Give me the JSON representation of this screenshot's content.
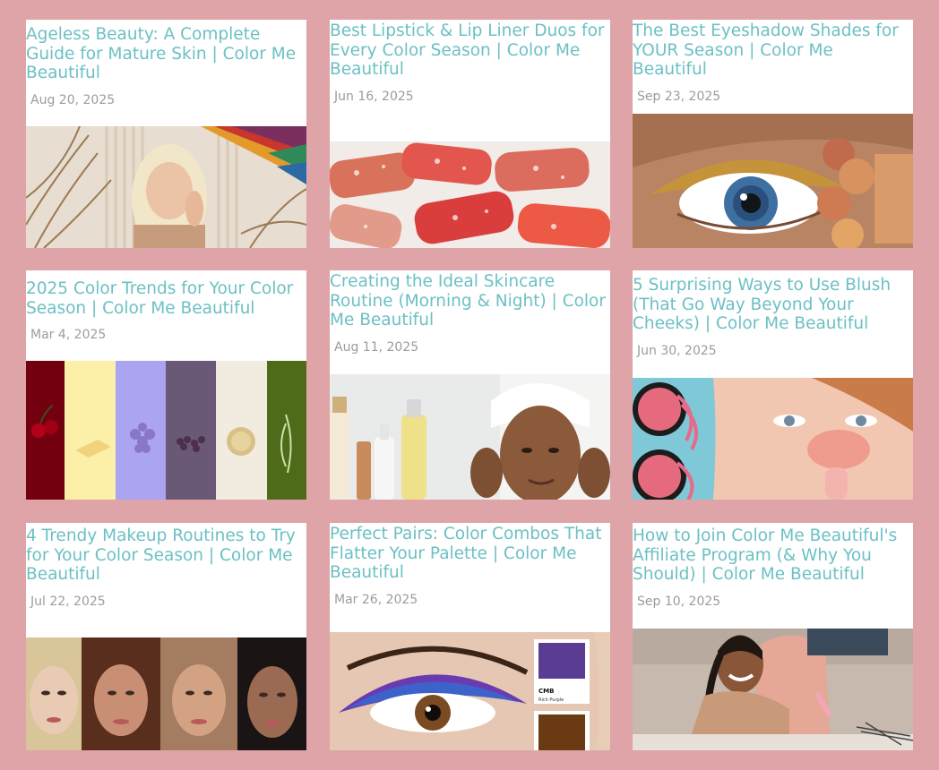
{
  "colors": {
    "page_background": "#dfa4a7",
    "card_background": "#ffffff",
    "title_color": "#6cc0c4",
    "date_color": "#9c9c9c"
  },
  "posts": [
    {
      "title": "Ageless Beauty: A Complete Guide for Mature Skin | Color Me Beautiful",
      "date": "Aug 20, 2025",
      "image": "mature-woman-with-color-fan-photo"
    },
    {
      "title": "Best Lipstick & Lip Liner Duos for Every Color Season | Color Me Beautiful",
      "date": "Jun 16, 2025",
      "image": "lipsticks-with-water-drops-photo"
    },
    {
      "title": "The Best Eyeshadow Shades for YOUR Season | Color Me Beautiful",
      "date": "Sep 23, 2025",
      "image": "blue-eye-with-gold-eyeshadow-photo"
    },
    {
      "title": "2025 Color Trends for Your Color Season | Color Me Beautiful",
      "date": "Mar 4, 2025",
      "image": "color-trend-stripes-photo"
    },
    {
      "title": "Creating the Ideal Skincare Routine (Morning & Night) | Color Me Beautiful",
      "date": "Aug 11, 2025",
      "image": "woman-with-towel-and-skincare-photo"
    },
    {
      "title": "5 Surprising Ways to Use Blush (That Go Way Beyond Your Cheeks) | Color Me Beautiful",
      "date": "Jun 30, 2025",
      "image": "woman-with-blush-compacts-photo"
    },
    {
      "title": "4 Trendy Makeup Routines to Try for Your Color Season | Color Me Beautiful",
      "date": "Jul 22, 2025",
      "image": "four-makeup-faces-photo"
    },
    {
      "title": "Perfect Pairs: Color Combos That Flatter Your Palette | Color Me Beautiful",
      "date": "Mar 26, 2025",
      "image": "purple-eye-makeup-with-swatches-photo",
      "swatch_text": "CMB",
      "swatch_subtext": "Rich Purple"
    },
    {
      "title": "How to Join Color Me Beautiful's Affiliate Program (& Why You Should) | Color Me Beautiful",
      "date": "Sep 10, 2025",
      "image": "woman-doing-nails-photo"
    }
  ]
}
